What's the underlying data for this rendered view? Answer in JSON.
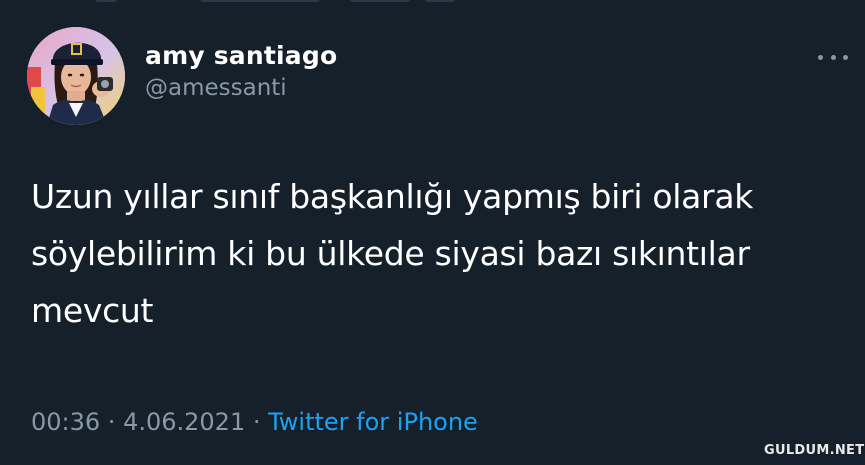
{
  "tweet": {
    "display_name": "amy santiago",
    "handle": "@amessanti",
    "text": "Uzun yıllar sınıf başkanlığı yapmış biri olarak\nsöylebilirim ki bu ülkede siyasi bazı sıkıntılar\nmevcut",
    "time": "00:36",
    "separator": " · ",
    "date": "4.06.2021",
    "source": "Twitter for iPhone"
  },
  "more_icon": "more-horizontal-icon",
  "watermark": "GULDUM.NET",
  "colors": {
    "background": "#15202b",
    "primary_text": "#ffffff",
    "secondary_text": "#8899a6",
    "link": "#1da1f2"
  }
}
